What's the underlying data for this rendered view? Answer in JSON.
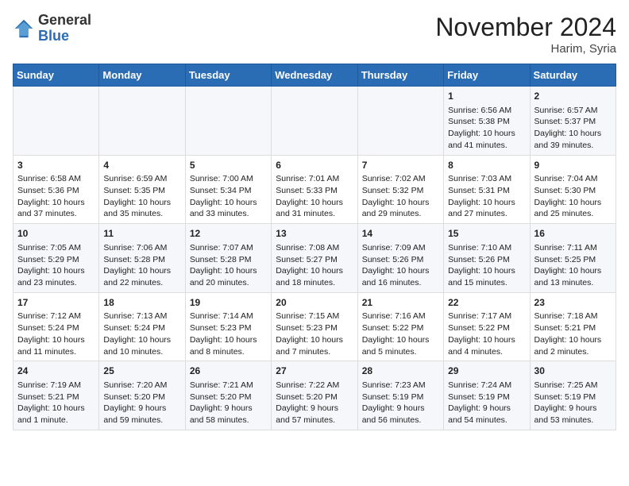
{
  "header": {
    "logo_line1": "General",
    "logo_line2": "Blue",
    "month": "November 2024",
    "location": "Harim, Syria"
  },
  "days_of_week": [
    "Sunday",
    "Monday",
    "Tuesday",
    "Wednesday",
    "Thursday",
    "Friday",
    "Saturday"
  ],
  "weeks": [
    [
      {
        "day": "",
        "info": ""
      },
      {
        "day": "",
        "info": ""
      },
      {
        "day": "",
        "info": ""
      },
      {
        "day": "",
        "info": ""
      },
      {
        "day": "",
        "info": ""
      },
      {
        "day": "1",
        "info": "Sunrise: 6:56 AM\nSunset: 5:38 PM\nDaylight: 10 hours and 41 minutes."
      },
      {
        "day": "2",
        "info": "Sunrise: 6:57 AM\nSunset: 5:37 PM\nDaylight: 10 hours and 39 minutes."
      }
    ],
    [
      {
        "day": "3",
        "info": "Sunrise: 6:58 AM\nSunset: 5:36 PM\nDaylight: 10 hours and 37 minutes."
      },
      {
        "day": "4",
        "info": "Sunrise: 6:59 AM\nSunset: 5:35 PM\nDaylight: 10 hours and 35 minutes."
      },
      {
        "day": "5",
        "info": "Sunrise: 7:00 AM\nSunset: 5:34 PM\nDaylight: 10 hours and 33 minutes."
      },
      {
        "day": "6",
        "info": "Sunrise: 7:01 AM\nSunset: 5:33 PM\nDaylight: 10 hours and 31 minutes."
      },
      {
        "day": "7",
        "info": "Sunrise: 7:02 AM\nSunset: 5:32 PM\nDaylight: 10 hours and 29 minutes."
      },
      {
        "day": "8",
        "info": "Sunrise: 7:03 AM\nSunset: 5:31 PM\nDaylight: 10 hours and 27 minutes."
      },
      {
        "day": "9",
        "info": "Sunrise: 7:04 AM\nSunset: 5:30 PM\nDaylight: 10 hours and 25 minutes."
      }
    ],
    [
      {
        "day": "10",
        "info": "Sunrise: 7:05 AM\nSunset: 5:29 PM\nDaylight: 10 hours and 23 minutes."
      },
      {
        "day": "11",
        "info": "Sunrise: 7:06 AM\nSunset: 5:28 PM\nDaylight: 10 hours and 22 minutes."
      },
      {
        "day": "12",
        "info": "Sunrise: 7:07 AM\nSunset: 5:28 PM\nDaylight: 10 hours and 20 minutes."
      },
      {
        "day": "13",
        "info": "Sunrise: 7:08 AM\nSunset: 5:27 PM\nDaylight: 10 hours and 18 minutes."
      },
      {
        "day": "14",
        "info": "Sunrise: 7:09 AM\nSunset: 5:26 PM\nDaylight: 10 hours and 16 minutes."
      },
      {
        "day": "15",
        "info": "Sunrise: 7:10 AM\nSunset: 5:26 PM\nDaylight: 10 hours and 15 minutes."
      },
      {
        "day": "16",
        "info": "Sunrise: 7:11 AM\nSunset: 5:25 PM\nDaylight: 10 hours and 13 minutes."
      }
    ],
    [
      {
        "day": "17",
        "info": "Sunrise: 7:12 AM\nSunset: 5:24 PM\nDaylight: 10 hours and 11 minutes."
      },
      {
        "day": "18",
        "info": "Sunrise: 7:13 AM\nSunset: 5:24 PM\nDaylight: 10 hours and 10 minutes."
      },
      {
        "day": "19",
        "info": "Sunrise: 7:14 AM\nSunset: 5:23 PM\nDaylight: 10 hours and 8 minutes."
      },
      {
        "day": "20",
        "info": "Sunrise: 7:15 AM\nSunset: 5:23 PM\nDaylight: 10 hours and 7 minutes."
      },
      {
        "day": "21",
        "info": "Sunrise: 7:16 AM\nSunset: 5:22 PM\nDaylight: 10 hours and 5 minutes."
      },
      {
        "day": "22",
        "info": "Sunrise: 7:17 AM\nSunset: 5:22 PM\nDaylight: 10 hours and 4 minutes."
      },
      {
        "day": "23",
        "info": "Sunrise: 7:18 AM\nSunset: 5:21 PM\nDaylight: 10 hours and 2 minutes."
      }
    ],
    [
      {
        "day": "24",
        "info": "Sunrise: 7:19 AM\nSunset: 5:21 PM\nDaylight: 10 hours and 1 minute."
      },
      {
        "day": "25",
        "info": "Sunrise: 7:20 AM\nSunset: 5:20 PM\nDaylight: 9 hours and 59 minutes."
      },
      {
        "day": "26",
        "info": "Sunrise: 7:21 AM\nSunset: 5:20 PM\nDaylight: 9 hours and 58 minutes."
      },
      {
        "day": "27",
        "info": "Sunrise: 7:22 AM\nSunset: 5:20 PM\nDaylight: 9 hours and 57 minutes."
      },
      {
        "day": "28",
        "info": "Sunrise: 7:23 AM\nSunset: 5:19 PM\nDaylight: 9 hours and 56 minutes."
      },
      {
        "day": "29",
        "info": "Sunrise: 7:24 AM\nSunset: 5:19 PM\nDaylight: 9 hours and 54 minutes."
      },
      {
        "day": "30",
        "info": "Sunrise: 7:25 AM\nSunset: 5:19 PM\nDaylight: 9 hours and 53 minutes."
      }
    ]
  ]
}
